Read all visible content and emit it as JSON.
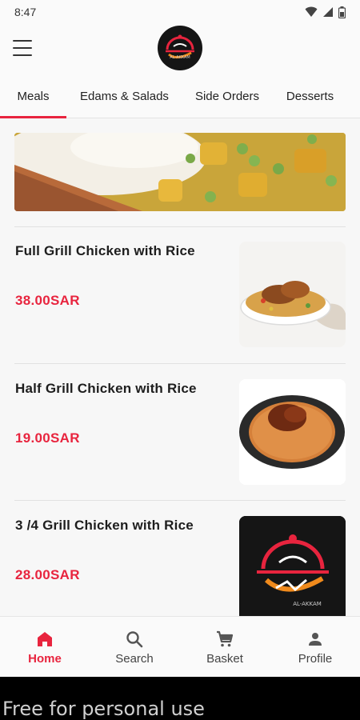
{
  "status_bar": {
    "time": "8:47"
  },
  "header": {
    "logo_icon": "restaurant-logo-icon",
    "menu_icon": "hamburger-menu-icon"
  },
  "tabs": [
    {
      "label": "Meals",
      "active": true
    },
    {
      "label": "Edams & Salads",
      "active": false
    },
    {
      "label": "Side Orders",
      "active": false
    },
    {
      "label": "Desserts",
      "active": false
    }
  ],
  "banner": {
    "image": "curry-and-rice-banner"
  },
  "meals": [
    {
      "name": "Full Grill Chicken with Rice",
      "price": "38.00SAR",
      "image": "full-grill-chicken-rice-photo"
    },
    {
      "name": "Half Grill Chicken with Rice",
      "price": "19.00SAR",
      "image": "half-grill-chicken-rice-photo"
    },
    {
      "name": "3 /4 Grill Chicken with Rice",
      "price": "28.00SAR",
      "image": "restaurant-logo-placeholder"
    }
  ],
  "bottom_nav": [
    {
      "label": "Home",
      "icon": "home-icon",
      "active": true
    },
    {
      "label": "Search",
      "icon": "search-icon",
      "active": false
    },
    {
      "label": "Basket",
      "icon": "cart-icon",
      "active": false
    },
    {
      "label": "Profile",
      "icon": "person-icon",
      "active": false
    }
  ],
  "footer": {
    "text": "Free for personal use"
  },
  "colors": {
    "accent": "#e8243e",
    "background": "#f7f7f7"
  }
}
